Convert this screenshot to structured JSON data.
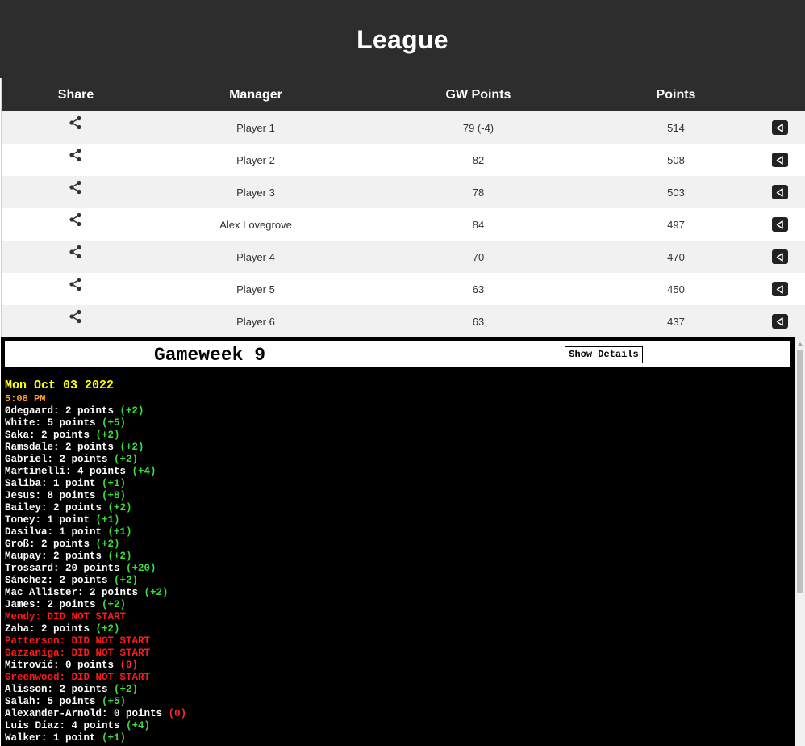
{
  "header": {
    "title": "League"
  },
  "table": {
    "columns": {
      "share": "Share",
      "manager": "Manager",
      "gw_points": "GW Points",
      "points": "Points"
    },
    "rows": [
      {
        "manager": "Player 1",
        "gw_points": "79 (-4)",
        "points": "514"
      },
      {
        "manager": "Player 2",
        "gw_points": "82",
        "points": "508"
      },
      {
        "manager": "Player 3",
        "gw_points": "78",
        "points": "503"
      },
      {
        "manager": "Alex Lovegrove",
        "gw_points": "84",
        "points": "497"
      },
      {
        "manager": "Player 4",
        "gw_points": "70",
        "points": "470"
      },
      {
        "manager": "Player 5",
        "gw_points": "63",
        "points": "450"
      },
      {
        "manager": "Player 6",
        "gw_points": "63",
        "points": "437"
      }
    ],
    "row_icons": {
      "share": "share-icon",
      "action": "back-triangle-icon"
    }
  },
  "gameweek": {
    "title": "Gameweek 9",
    "show_details_label": "Show Details",
    "date": "Mon Oct 03 2022",
    "time": "5:08 PM",
    "events": [
      {
        "text": "Ødegaard: 2 points",
        "delta": "(+2)"
      },
      {
        "text": "White: 5 points",
        "delta": "(+5)"
      },
      {
        "text": "Saka: 2 points",
        "delta": "(+2)"
      },
      {
        "text": "Ramsdale: 2 points",
        "delta": "(+2)"
      },
      {
        "text": "Gabriel: 2 points",
        "delta": "(+2)"
      },
      {
        "text": "Martinelli: 4 points",
        "delta": "(+4)"
      },
      {
        "text": "Saliba: 1 point",
        "delta": "(+1)"
      },
      {
        "text": "Jesus: 8 points",
        "delta": "(+8)"
      },
      {
        "text": "Bailey: 2 points",
        "delta": "(+2)"
      },
      {
        "text": "Toney: 1 point",
        "delta": "(+1)"
      },
      {
        "text": "Dasilva: 1 point",
        "delta": "(+1)"
      },
      {
        "text": "Groß: 2 points",
        "delta": "(+2)"
      },
      {
        "text": "Maupay: 2 points",
        "delta": "(+2)"
      },
      {
        "text": "Trossard: 20 points",
        "delta": "(+20)"
      },
      {
        "text": "Sánchez: 2 points",
        "delta": "(+2)"
      },
      {
        "text": "Mac Allister: 2 points",
        "delta": "(+2)"
      },
      {
        "text": "James: 2 points",
        "delta": "(+2)"
      },
      {
        "text": "Mendy: DID NOT START",
        "delta": "",
        "dns": true
      },
      {
        "text": "Zaha: 2 points",
        "delta": "(+2)"
      },
      {
        "text": "Patterson: DID NOT START",
        "delta": "",
        "dns": true
      },
      {
        "text": "Gazzaniga: DID NOT START",
        "delta": "",
        "dns": true
      },
      {
        "text": "Mitrović: 0 points",
        "delta": "(0)"
      },
      {
        "text": "Greenwood: DID NOT START",
        "delta": "",
        "dns": true
      },
      {
        "text": "Alisson: 2 points",
        "delta": "(+2)"
      },
      {
        "text": "Salah: 5 points",
        "delta": "(+5)"
      },
      {
        "text": "Alexander-Arnold: 0 points",
        "delta": "(0)"
      },
      {
        "text": "Luis Díaz: 4 points",
        "delta": "(+4)"
      },
      {
        "text": "Walker: 1 point",
        "delta": "(+1)"
      }
    ]
  },
  "colors": {
    "header_bg": "#2d2d2d",
    "console_bg": "#000000",
    "date": "#ffff00",
    "time": "#ff9e3d",
    "positive": "#3ddc3d",
    "dns": "#ff1a1a"
  }
}
